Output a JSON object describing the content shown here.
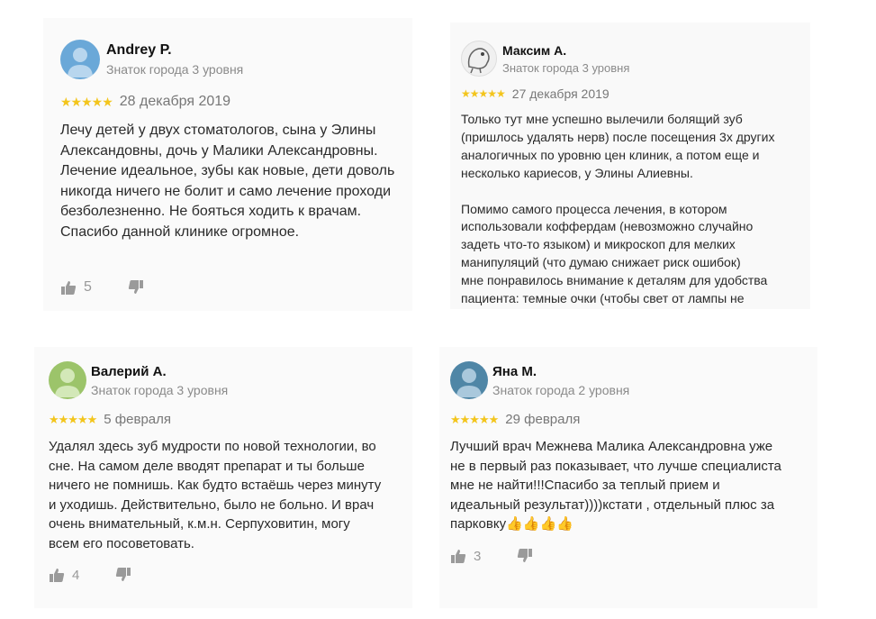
{
  "reviews": [
    {
      "author": "Andrey P.",
      "level": "Знаток города 3 уровня",
      "stars": "★★★★★",
      "date": "28 декабря 2019",
      "text": "Лечу детей у двух стоматологов, сына у Элины\nАлександовны, дочь у Малики Александровны.\nЛечение идеальное, зубы как новые, дети доволь\nникогда ничего не болит и само лечение проходи\nбезболезненно. Не бояться ходить к врачам.\nСпасибо данной клинике огромное.",
      "likes": "5",
      "avatar_color": "#6aa8d8"
    },
    {
      "author": "Максим А.",
      "level": "Знаток города 3 уровня",
      "stars": "★★★★★",
      "date": "27 декабря 2019",
      "text": "Только тут мне успешно вылечили болящий зуб\n(пришлось удалять нерв) после посещения 3х других\nаналогичных по уровню цен клиник, а потом еще и\nнесколько кариесов, у Элины Алиевны.\n\nПомимо самого процесса лечения, в котором\nиспользовали коффердам (невозможно случайно\nзадеть что-то языком) и микроскоп для мелких\nманипуляций (что думаю снижает риск ошибок)\nмне понравилось внимание к деталям для удобства\nпациента: темные очки (чтобы свет от лампы не",
      "avatar_color": "#e8e8e8"
    },
    {
      "author": "Валерий А.",
      "level": "Знаток города 3 уровня",
      "stars": "★★★★★",
      "date": "5 февраля",
      "text": "Удалял здесь зуб мудрости по новой технологии, во\nсне. На самом деле вводят препарат и ты больше\nничего не помнишь. Как будто встаёшь через минуту\nи уходишь. Действительно, было не больно. И врач\nочень внимательный, к.м.н. Серпуховитин, могу\nвсем его посоветовать.",
      "likes": "4",
      "avatar_color": "#9cc46a"
    },
    {
      "author": "Яна М.",
      "level": "Знаток города 2 уровня",
      "stars": "★★★★★",
      "date": "29 февраля",
      "text": "Лучший врач Межнева Малика Александровна уже\nне в первый раз показывает, что лучше специалиста\nмне не найти!!!Спасибо за теплый прием и\nидеальный результат))))кстати , отдельный плюс за\nпарковку",
      "emoji": "👍👍👍👍",
      "likes": "3",
      "avatar_color": "#4f86a6"
    }
  ],
  "icons": {
    "like": "thumbs-up-icon",
    "dislike": "thumbs-down-icon"
  }
}
